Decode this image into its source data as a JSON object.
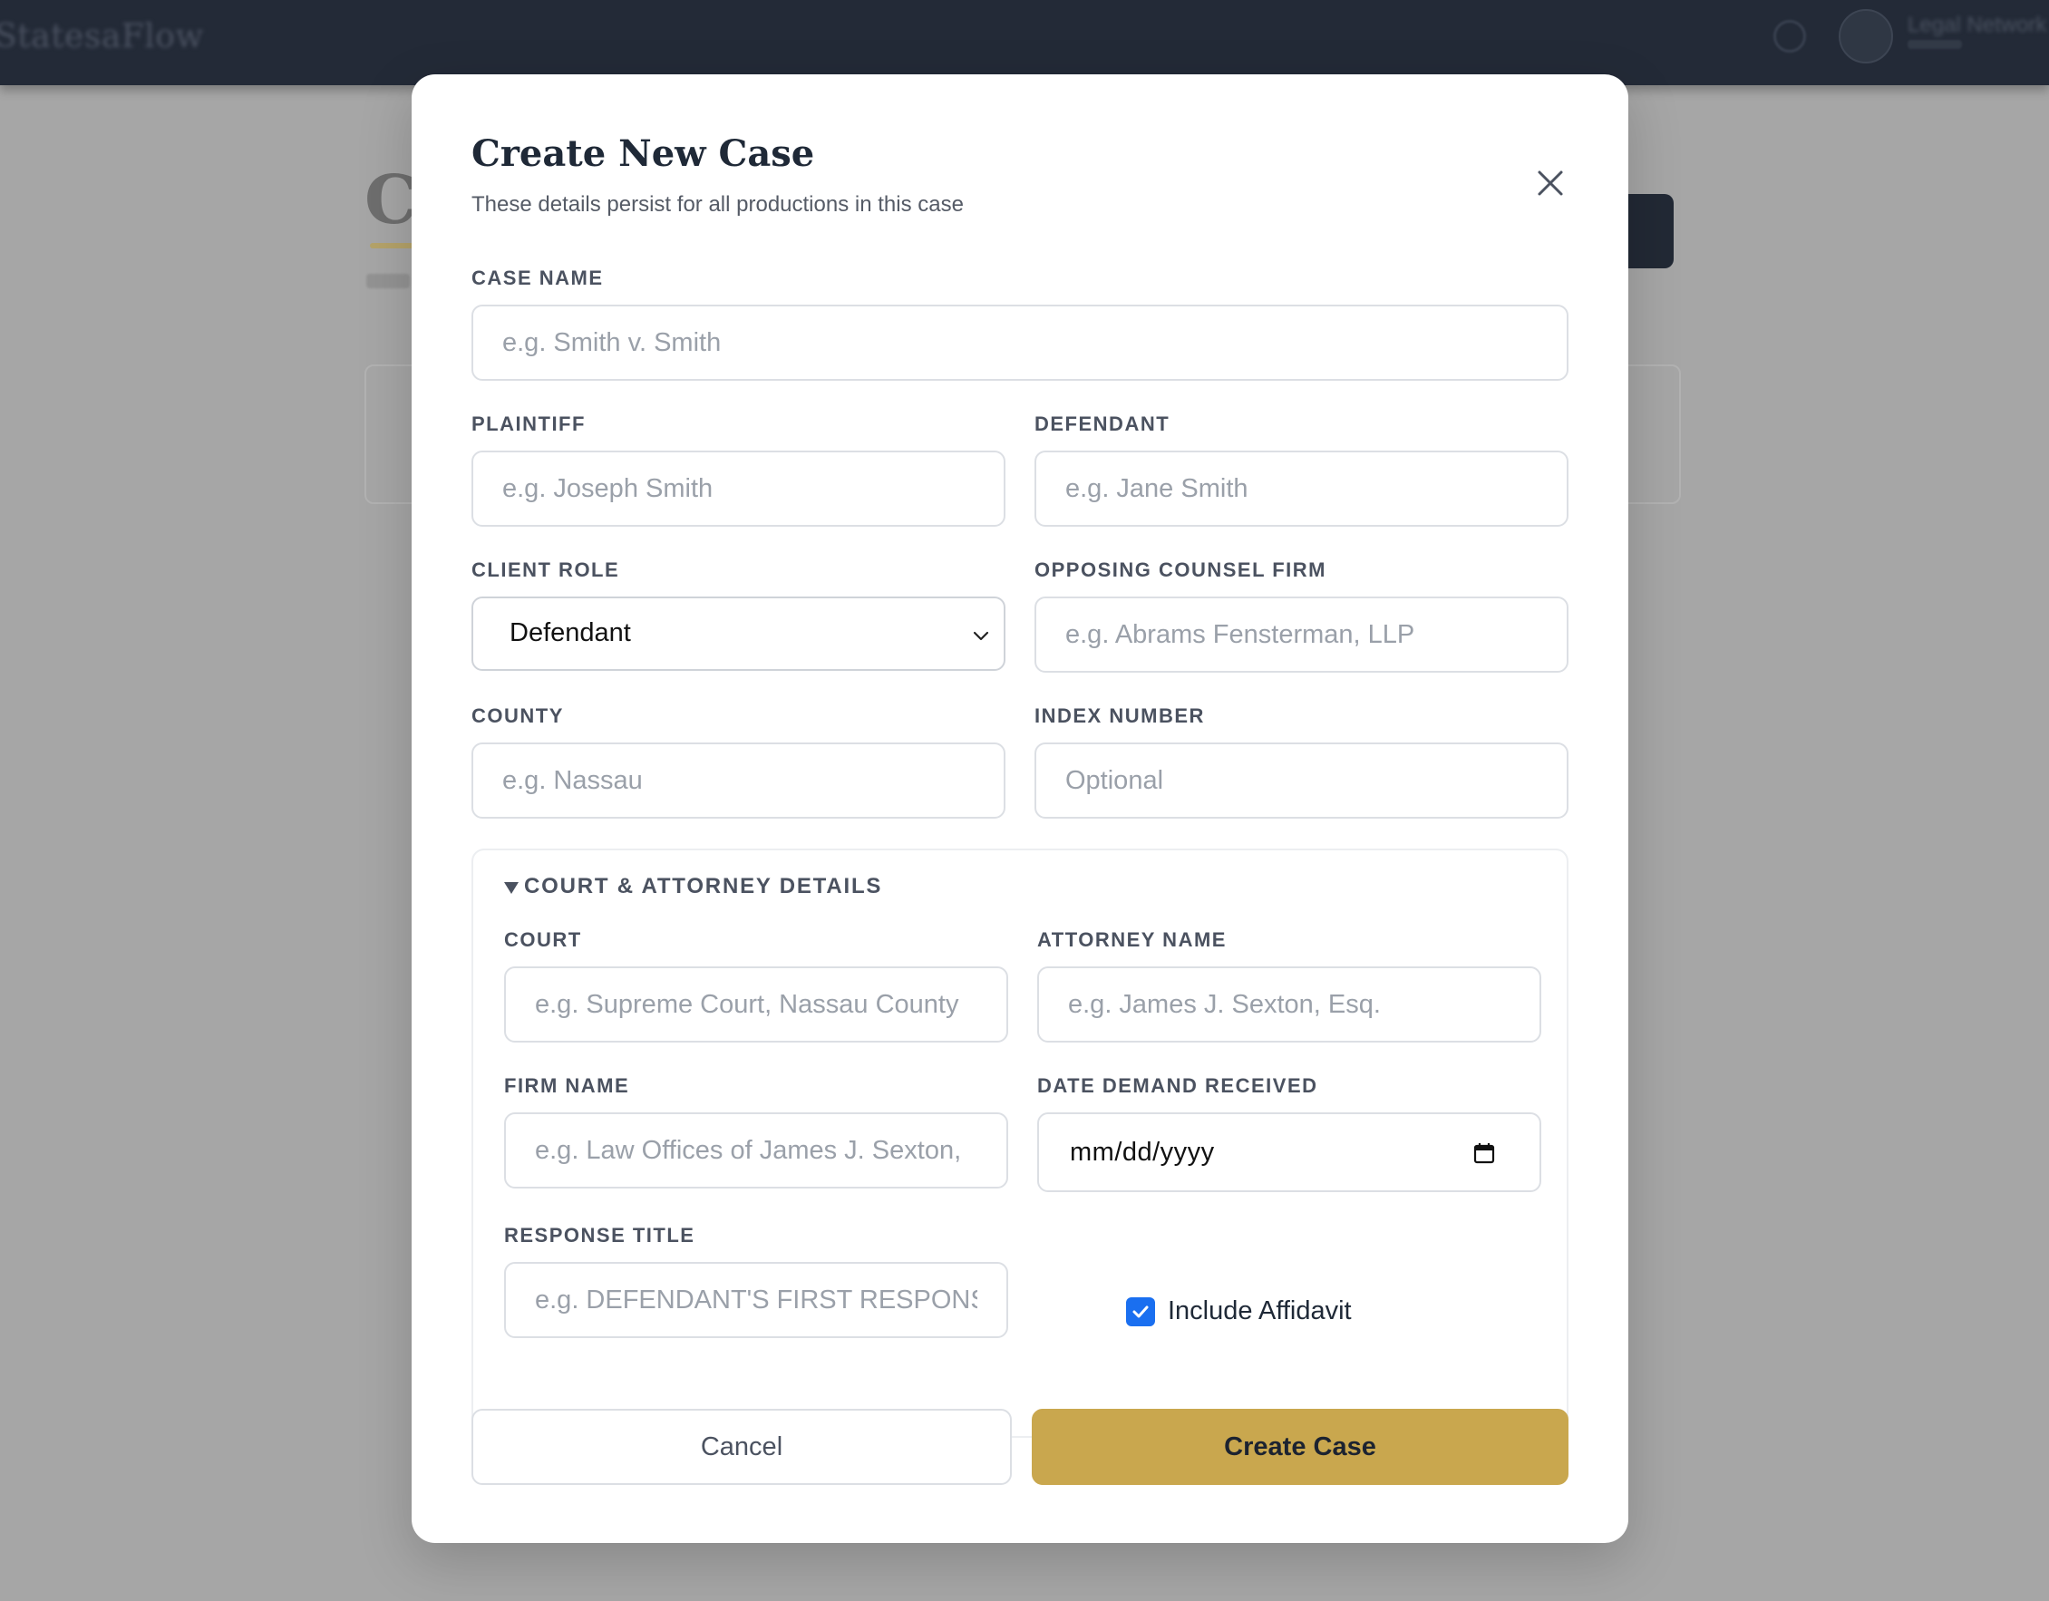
{
  "background": {
    "app_logo": "StatesaFlow",
    "page_title_initial": "C",
    "user_name": "Legal Network"
  },
  "modal": {
    "title": "Create New Case",
    "subtitle": "These details persist for all productions in this case",
    "close_icon": "close-icon"
  },
  "fields": {
    "case_name": {
      "label": "CASE NAME",
      "placeholder": "e.g. Smith v. Smith"
    },
    "plaintiff": {
      "label": "PLAINTIFF",
      "placeholder": "e.g. Joseph Smith"
    },
    "defendant": {
      "label": "DEFENDANT",
      "placeholder": "e.g. Jane Smith"
    },
    "client_role": {
      "label": "CLIENT ROLE",
      "value": "Defendant"
    },
    "opposing_counsel_firm": {
      "label": "OPPOSING COUNSEL FIRM",
      "placeholder": "e.g. Abrams Fensterman, LLP"
    },
    "county": {
      "label": "COUNTY",
      "placeholder": "e.g. Nassau"
    },
    "index_number": {
      "label": "INDEX NUMBER",
      "placeholder": "Optional"
    }
  },
  "details": {
    "summary": "COURT & ATTORNEY DETAILS",
    "expanded": true,
    "court": {
      "label": "COURT",
      "placeholder": "e.g. Supreme Court, Nassau County"
    },
    "attorney_name": {
      "label": "ATTORNEY NAME",
      "placeholder": "e.g. James J. Sexton, Esq."
    },
    "firm_name": {
      "label": "FIRM NAME",
      "placeholder": "e.g. Law Offices of James J. Sexton,"
    },
    "date_demand_received": {
      "label": "DATE DEMAND RECEIVED",
      "value": "mm/dd/yyyy"
    },
    "response_title": {
      "label": "RESPONSE TITLE",
      "placeholder": "e.g. DEFENDANT'S FIRST RESPONSE"
    },
    "include_affidavit": {
      "label": "Include Affidavit",
      "checked": true
    }
  },
  "actions": {
    "cancel_label": "Cancel",
    "create_label": "Create Case"
  },
  "colors": {
    "header_bg": "#232a37",
    "accent_gold": "#c9a74e",
    "checkbox_blue": "#1a6ff0"
  }
}
